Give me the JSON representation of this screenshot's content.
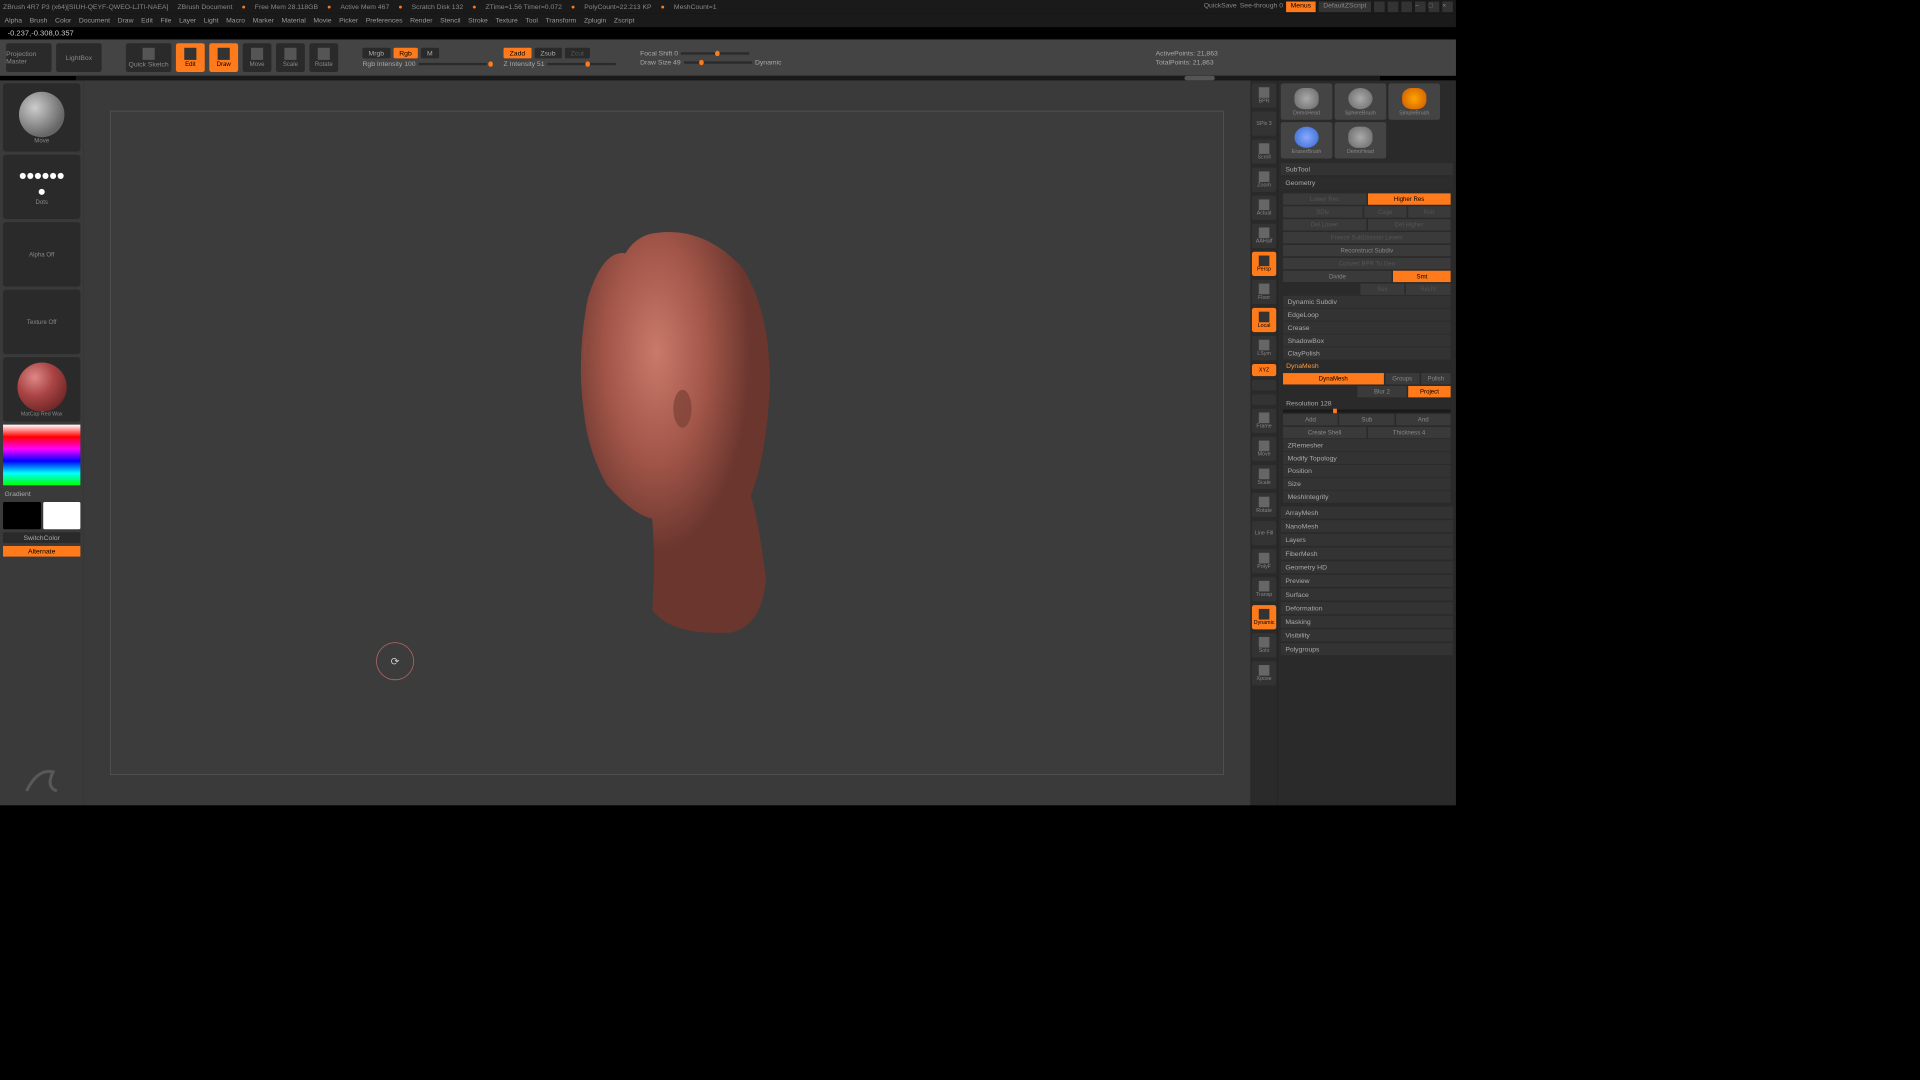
{
  "titlebar": {
    "app": "ZBrush 4R7 P3 (x64)[SIUH-QEYF-QWEO-LJTI-NAEA]",
    "doc": "ZBrush Document",
    "mem": "Free Mem 28.118GB",
    "active_mem": "Active Mem 467",
    "scratch": "Scratch Disk 132",
    "ztime": "ZTime=1.56 Timer=0.072",
    "polycount": "PolyCount=22.213 KP",
    "meshcount": "MeshCount=1",
    "quicksave": "QuickSave",
    "seethrough": "See-through 0",
    "menus": "Menus",
    "script": "DefaultZScript"
  },
  "menubar": [
    "Alpha",
    "Brush",
    "Color",
    "Document",
    "Draw",
    "Edit",
    "File",
    "Layer",
    "Light",
    "Macro",
    "Marker",
    "Material",
    "Movie",
    "Picker",
    "Preferences",
    "Render",
    "Stencil",
    "Stroke",
    "Texture",
    "Tool",
    "Transform",
    "Zplugin",
    "Zscript"
  ],
  "status": "-0.237,-0.308,0.357",
  "toolbar": {
    "projection": "Projection Master",
    "lightbox": "LightBox",
    "quicksketch": "Quick Sketch",
    "edit": "Edit",
    "draw": "Draw",
    "move": "Move",
    "scale": "Scale",
    "rotate": "Rotate",
    "mrgb": "Mrgb",
    "rgb": "Rgb",
    "m": "M",
    "rgbint": "Rgb Intensity 100",
    "zadd": "Zadd",
    "zsub": "Zsub",
    "zcut": "Zcut",
    "zint": "Z Intensity 51",
    "focal": "Focal Shift 0",
    "drawsize": "Draw Size 49",
    "dynamic": "Dynamic",
    "activepoints": "ActivePoints: 21,863",
    "totalpoints": "TotalPoints: 21,863"
  },
  "left": {
    "brush": "Move",
    "stroke": "Dots",
    "alpha": "Alpha Off",
    "texture": "Texture Off",
    "material": "MatCap Red Wax",
    "gradient": "Gradient",
    "switchcolor": "SwitchColor",
    "alternate": "Alternate"
  },
  "dock": [
    "BPR",
    "SPix 3",
    "Scroll",
    "Zoom",
    "Actual",
    "AAHalf",
    "Persp",
    "Floor",
    "Local",
    "LSym",
    "XYZ",
    "",
    "",
    "Frame",
    "Move",
    "Scale",
    "Rotate",
    "Line Fill",
    "PolyF",
    "Transp",
    "Dynamic",
    "Solo",
    "Xpose"
  ],
  "right": {
    "tools": [
      "DemoHead",
      "SphereBrush",
      "SimpleBrush",
      "EraserBrush",
      "DemoHead"
    ],
    "subtool": "SubTool",
    "geometry": "Geometry",
    "lowerres": "Lower Res",
    "higherres": "Higher Res",
    "sdiv": "SDiv",
    "cage": "Cage",
    "rstr": "Rstr",
    "dellower": "Del Lower",
    "delhigher": "Del Higher",
    "freeze": "Freeze SubDivision Levels",
    "reconstruct": "Reconstruct Subdiv",
    "convert": "Convert BPR To Geo",
    "divide": "Divide",
    "smt": "Smt",
    "suv": "Suv",
    "resh": "ReUV",
    "dynsubdiv": "Dynamic Subdiv",
    "edgeloop": "EdgeLoop",
    "crease": "Crease",
    "shadowbox": "ShadowBox",
    "claypolish": "ClayPolish",
    "dynamesh": "DynaMesh",
    "dynameshbtn": "DynaMesh",
    "groups": "Groups",
    "polish": "Polish",
    "blur": "Blur 2",
    "project": "Project",
    "resolution": "Resolution 128",
    "add": "Add",
    "sub": "Sub",
    "and": "And",
    "createshell": "Create Shell",
    "thickness": "Thickness 4",
    "zremesher": "ZRemesher",
    "modifytop": "Modify Topology",
    "position": "Position",
    "size": "Size",
    "meshint": "MeshIntegrity",
    "arraymesh": "ArrayMesh",
    "nanomesh": "NanoMesh",
    "layers": "Layers",
    "fibermesh": "FiberMesh",
    "geohd": "Geometry HD",
    "preview": "Preview",
    "surface": "Surface",
    "deformation": "Deformation",
    "masking": "Masking",
    "visibility": "Visibility",
    "polygroups": "Polygroups"
  }
}
